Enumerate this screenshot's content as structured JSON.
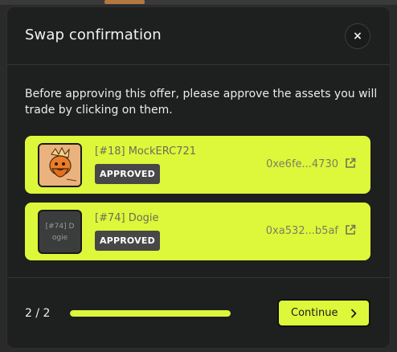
{
  "modal": {
    "title": "Swap confirmation",
    "close_label": "×",
    "instructions": "Before approving this offer, please approve the assets you will trade by clicking on them."
  },
  "assets": [
    {
      "name": "[#18] MockERC721",
      "status": "APPROVED",
      "address": "0xe6fe...4730",
      "thumbnail": "image",
      "icon": "external-link-icon"
    },
    {
      "name": "[#74] Dogie",
      "status": "APPROVED",
      "address": "0xa532...b5af",
      "thumbnail_text_line1": "[#74] D",
      "thumbnail_text_line2": "ogie",
      "icon": "external-link-icon"
    }
  ],
  "footer": {
    "step": "2 / 2",
    "progress": 1.0,
    "continue_label": "Continue",
    "continue_icon": "chevron-right-icon"
  },
  "colors": {
    "accent": "#ddf73a",
    "background": "#1e1f1f",
    "badge": "#474747"
  }
}
